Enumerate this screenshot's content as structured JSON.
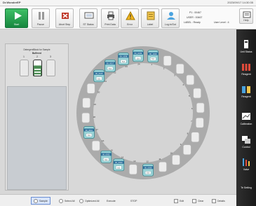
{
  "titlebar": {
    "app": "Dr.WonderEP",
    "datetime": "2023/09/17 14:30:35"
  },
  "toolbar": {
    "buttons": [
      {
        "label": "Start",
        "icon": "play-icon"
      },
      {
        "label": "Pause",
        "icon": "pause-icon"
      },
      {
        "label": "Abort Step",
        "icon": "abort-icon"
      },
      {
        "label": "ST Status",
        "icon": "status-icon"
      },
      {
        "label": "Print Data",
        "icon": "printer-icon"
      },
      {
        "label": "Error",
        "icon": "warning-icon"
      },
      {
        "label": "Label",
        "icon": "label-icon"
      },
      {
        "label": "Log in/Out",
        "icon": "user-icon"
      }
    ],
    "info": {
      "p1": "P1 : 00467",
      "user": "USER : 00467",
      "label_status": "LABEL : Ready",
      "user_level": "User Level : 4"
    },
    "help": "Help"
  },
  "panel": {
    "title": "DetergentBlock for Sample",
    "subtitle": "Buffered",
    "bottle_labels": [
      "1",
      "2",
      "3"
    ],
    "selected_bottle": 2
  },
  "carousel": {
    "selected_color": "#9ad4d8",
    "empty_color": "#ececec",
    "positions": [
      {
        "n": "1",
        "sample": "00_1040",
        "amount": "5.0",
        "filled": true
      },
      {
        "n": "2",
        "sample": "",
        "amount": "",
        "filled": false
      },
      {
        "n": "3",
        "sample": "",
        "amount": "",
        "filled": false
      },
      {
        "n": "4",
        "sample": "",
        "amount": "",
        "filled": false
      },
      {
        "n": "5",
        "sample": "",
        "amount": "",
        "filled": false
      },
      {
        "n": "6",
        "sample": "",
        "amount": "",
        "filled": false
      },
      {
        "n": "7",
        "sample": "",
        "amount": "",
        "filled": false
      },
      {
        "n": "8",
        "sample": "",
        "amount": "",
        "filled": false
      },
      {
        "n": "9",
        "sample": "",
        "amount": "",
        "filled": false
      },
      {
        "n": "10",
        "sample": "",
        "amount": "",
        "filled": false
      },
      {
        "n": "11",
        "sample": "",
        "amount": "",
        "filled": false
      },
      {
        "n": "12",
        "sample": "00_0035",
        "amount": "5.0",
        "filled": true
      },
      {
        "n": "13",
        "sample": "",
        "amount": "",
        "filled": false
      },
      {
        "n": "14",
        "sample": "00_0033",
        "amount": "5.0",
        "filled": true
      },
      {
        "n": "15",
        "sample": "00_0032",
        "amount": "5.0",
        "filled": true
      },
      {
        "n": "16",
        "sample": "",
        "amount": "",
        "filled": false
      },
      {
        "n": "17",
        "sample": "00_0011",
        "amount": "5.0",
        "filled": true
      },
      {
        "n": "18",
        "sample": "",
        "amount": "",
        "filled": false
      },
      {
        "n": "19",
        "sample": "",
        "amount": "",
        "filled": false
      },
      {
        "n": "20",
        "sample": "",
        "amount": "",
        "filled": false
      },
      {
        "n": "21",
        "sample": "00_0015",
        "amount": "5.0",
        "filled": true
      },
      {
        "n": "22",
        "sample": "00_0017",
        "amount": "5.0",
        "filled": true
      },
      {
        "n": "23",
        "sample": "00_1038",
        "amount": "5.0",
        "filled": true
      },
      {
        "n": "24",
        "sample": "00_1039",
        "amount": "5.0",
        "filled": true
      }
    ]
  },
  "sidebar": [
    {
      "label": "Unit Status",
      "icon": "unit-status-icon"
    },
    {
      "label": "Reagent",
      "icon": "reagent-icon"
    },
    {
      "label": "Reagent",
      "icon": "reagent-bottles-icon"
    },
    {
      "label": "Calibration",
      "icon": "calibration-icon"
    },
    {
      "label": "Control",
      "icon": "control-icon"
    },
    {
      "label": "Valve",
      "icon": "valve-icon"
    },
    {
      "label": "Te Setting",
      "icon": "setting-icon"
    }
  ],
  "bottombar": {
    "sample": "Sample",
    "select_all": "Select All",
    "optimized": "Optimized All",
    "execute": "Execute",
    "stop": "STOP",
    "edit": "Edit",
    "clear": "Clear",
    "details": "Details"
  }
}
